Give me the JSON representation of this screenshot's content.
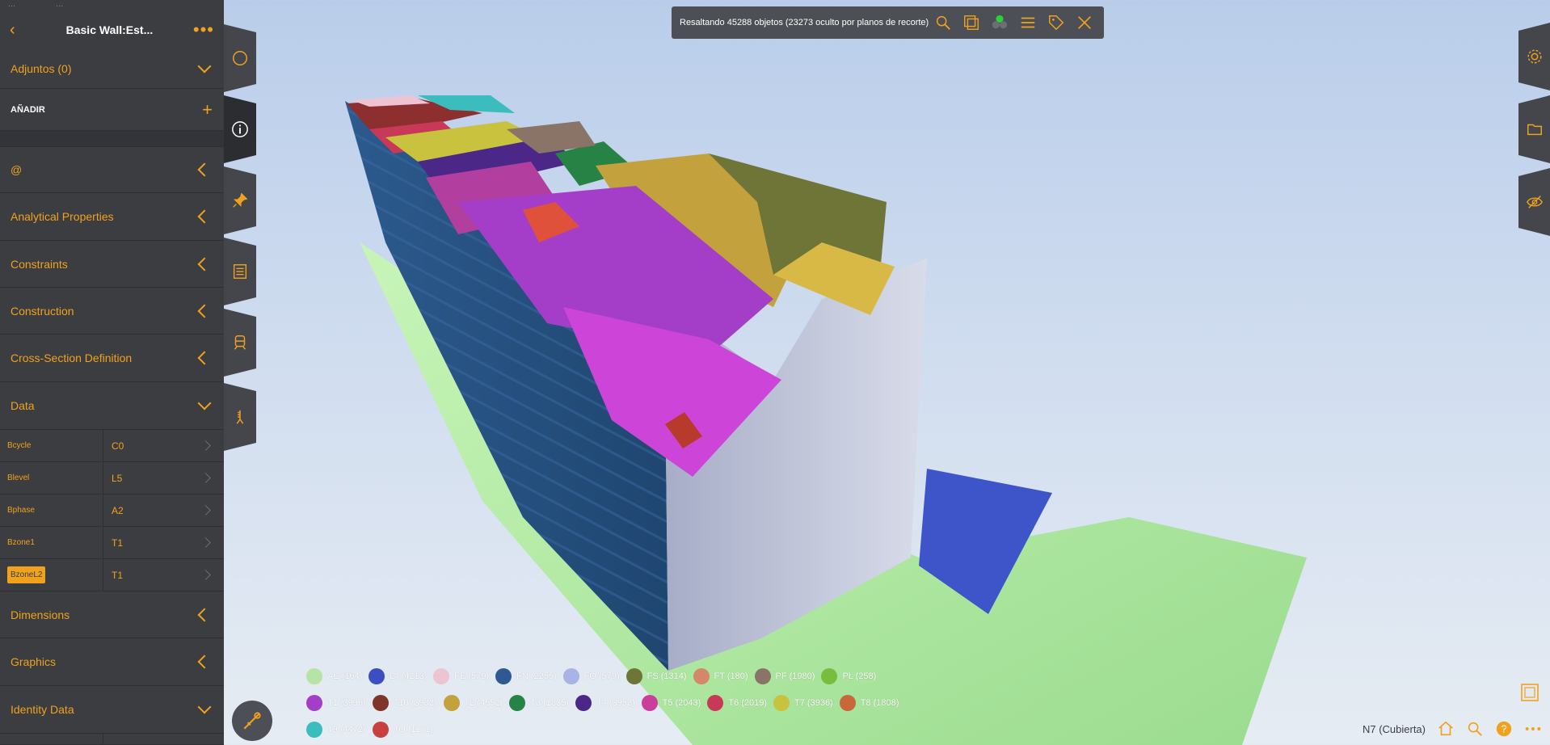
{
  "panel": {
    "ghost_left": "...",
    "ghost_right": "...",
    "header_title": "Basic Wall:Est...",
    "back_glyph": "‹",
    "more_glyph": "•••",
    "attachments_label": "Adjuntos (0)",
    "add_label": "AÑADIR",
    "sections": [
      {
        "label": "@"
      },
      {
        "label": "Analytical Properties"
      },
      {
        "label": "Constraints"
      },
      {
        "label": "Construction"
      },
      {
        "label": "Cross-Section Definition"
      },
      {
        "label": "Data"
      }
    ],
    "properties": [
      {
        "key": "Bcycle",
        "value": "C0"
      },
      {
        "key": "Blevel",
        "value": "L5"
      },
      {
        "key": "Bphase",
        "value": "A2"
      },
      {
        "key": "Bzone1",
        "value": "T1"
      },
      {
        "key": "BzoneL2",
        "value": "T1"
      }
    ],
    "sections_after": [
      {
        "label": "Dimensions"
      },
      {
        "label": "Graphics"
      },
      {
        "label": "Identity Data"
      }
    ]
  },
  "toolbar": {
    "message": "Resaltando 45288 objetos (23273 oculto por planos de recorte)",
    "icons": [
      "zoom-icon",
      "layers-icon",
      "color-circles-icon",
      "list-icon",
      "tag-icon",
      "close-icon"
    ]
  },
  "left_tabs": [
    "circle-icon",
    "info-icon",
    "pin-icon",
    "checklist-icon",
    "train-icon",
    "measure-icon"
  ],
  "right_tabs": [
    "gear-icon",
    "folder-icon",
    "eye-slash-icon"
  ],
  "legend": {
    "rows": [
      [
        {
          "label": "AE (164)",
          "color": "#b6e3a6"
        },
        {
          "label": "DI (4213)",
          "color": "#3b4fc1"
        },
        {
          "label": "FE (579)",
          "color": "#eec4d3"
        },
        {
          "label": "FN (2255)",
          "color": "#2d5a93"
        },
        {
          "label": "FO (579)",
          "color": "#aab3e6"
        },
        {
          "label": "FS (1314)",
          "color": "#6e7536"
        },
        {
          "label": "FT (180)",
          "color": "#d5876c"
        },
        {
          "label": "PF (1980)",
          "color": "#8a7467"
        },
        {
          "label": "PL (258)",
          "color": "#79bd3d"
        }
      ],
      [
        {
          "label": "T1 (3996)",
          "color": "#a43ec9"
        },
        {
          "label": "T10 (3982)",
          "color": "#7e3428"
        },
        {
          "label": "T2 (4552)",
          "color": "#c3a23e"
        },
        {
          "label": "T3 (1835)",
          "color": "#278246"
        },
        {
          "label": "T4 (3952)",
          "color": "#4b2788"
        },
        {
          "label": "T5 (2043)",
          "color": "#cb3f9c"
        },
        {
          "label": "T6 (2019)",
          "color": "#c83958"
        },
        {
          "label": "T7 (3936)",
          "color": "#c8c23e"
        },
        {
          "label": "T8 (1808)",
          "color": "#c8673a"
        }
      ],
      [
        {
          "label": "T9 (4472)",
          "color": "#3bbdbd"
        },
        {
          "label": "TO (1171)",
          "color": "#c84040"
        }
      ]
    ]
  },
  "status": {
    "level": "N7 (Cubierta)",
    "icons": [
      "home-icon",
      "zoom-icon",
      "help-icon",
      "more-icon"
    ]
  },
  "colors": {
    "accent": "#f0a21e",
    "panel_bg": "#3b3d41",
    "toolbar_bg": "#4c4f55"
  }
}
